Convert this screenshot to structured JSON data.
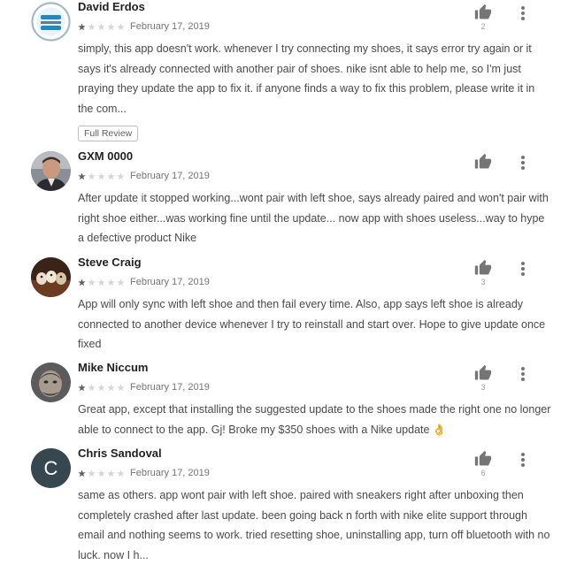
{
  "reviews": [
    {
      "author": "David Erdos",
      "rating": 1,
      "date": "February 17, 2019",
      "helpful_count": "2",
      "text": "simply, this app doesn't work. whenever I try connecting my shoes, it says error try again or it says it's already connected with another pair of shoes. nike isnt able to help me, so I'm just praying they update the app to fix it. if anyone finds a way to fix this problem, please write it in the com...",
      "full_review_label": "Full Review"
    },
    {
      "author": "GXM 0000",
      "rating": 1,
      "date": "February 17, 2019",
      "helpful_count": "",
      "text": "After update it stopped working...wont pair with left shoe, says already paired and won't pair with right shoe either...was working fine until the update... now app with shoes useless...way to hype a defective product Nike"
    },
    {
      "author": "Steve Craig",
      "rating": 1,
      "date": "February 17, 2019",
      "helpful_count": "3",
      "text": "App will only sync with left shoe and then fail every time. Also, app says left shoe is already connected to another device whenever I try to reinstall and start over. Hope to give update once fixed"
    },
    {
      "author": "Mike Niccum",
      "rating": 1,
      "date": "February 17, 2019",
      "helpful_count": "3",
      "text": "Great app, except that installing the suggested update to the shoes made the right one no longer able to connect to the app. Gj! Broke my $350 shoes with a Nike update 👌"
    },
    {
      "author": "Chris Sandoval",
      "avatar_letter": "C",
      "rating": 1,
      "date": "February 17, 2019",
      "helpful_count": "6",
      "text": "same as others. app wont pair with left shoe. paired with sneakers right after unboxing then completely crashed after last update. been going back n forth with nike elite support through email and nothing seems to work. tried resetting shoe, uninstalling app, turn off bluetooth with no luck. now I h..."
    }
  ],
  "icons": {
    "helpful": "thumbs-up-icon",
    "more": "more-vert-icon",
    "star": "star-icon"
  },
  "colors": {
    "star_filled": "#616161",
    "star_empty": "#d6d6d6",
    "icon": "#757575",
    "chris_avatar": "#37474f"
  }
}
